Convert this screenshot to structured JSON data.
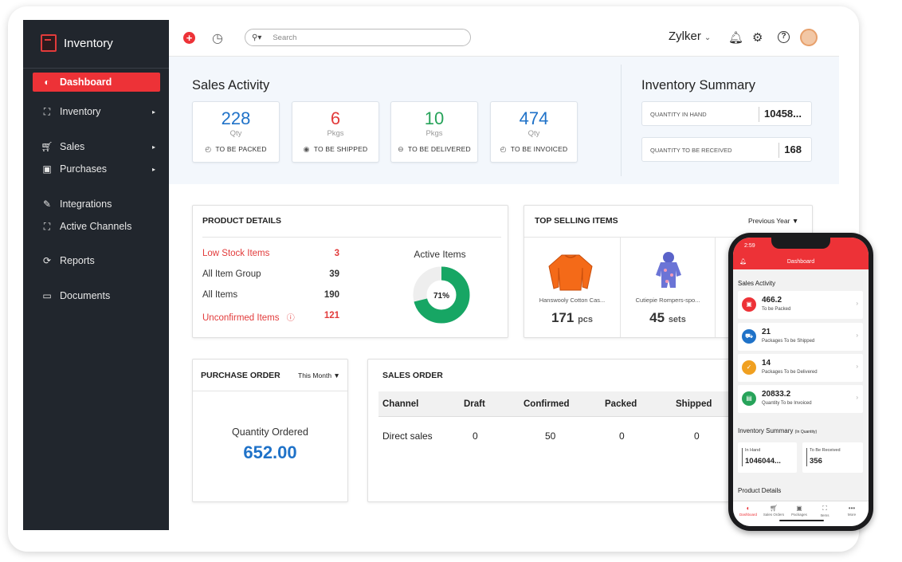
{
  "sidebar": {
    "app_name": "Inventory",
    "items": [
      {
        "label": "Dashboard",
        "icon": "dashboard-icon"
      },
      {
        "label": "Inventory",
        "icon": "inventory-icon",
        "arrow": "▸"
      },
      {
        "label": "Sales",
        "icon": "cart-icon",
        "arrow": "▸"
      },
      {
        "label": "Purchases",
        "icon": "bag-icon",
        "arrow": "▸"
      },
      {
        "label": "Integrations",
        "icon": "integrations-icon"
      },
      {
        "label": "Active Channels",
        "icon": "channels-icon"
      },
      {
        "label": "Reports",
        "icon": "reports-icon"
      },
      {
        "label": "Documents",
        "icon": "folder-icon"
      }
    ]
  },
  "topbar": {
    "search_placeholder": "Search",
    "org_name": "Zylker"
  },
  "sales_activity": {
    "title": "Sales Activity",
    "cards": [
      {
        "value": "228",
        "unit": "Qty",
        "label": "TO BE PACKED",
        "color": "#1f72c8"
      },
      {
        "value": "6",
        "unit": "Pkgs",
        "label": "TO BE SHIPPED",
        "color": "#e23b3b"
      },
      {
        "value": "10",
        "unit": "Pkgs",
        "label": "TO BE DELIVERED",
        "color": "#27a35a"
      },
      {
        "value": "474",
        "unit": "Qty",
        "label": "TO BE INVOICED",
        "color": "#1f72c8"
      }
    ]
  },
  "inventory_summary": {
    "title": "Inventory Summary",
    "in_hand_label": "QUANTITY IN HAND",
    "in_hand_value": "10458...",
    "to_receive_label": "QUANTITY TO BE RECEIVED",
    "to_receive_value": "168"
  },
  "product_details": {
    "title": "PRODUCT DETAILS",
    "rows": [
      {
        "label": "Low Stock Items",
        "value": "3",
        "alert": true
      },
      {
        "label": "All Item Group",
        "value": "39",
        "alert": false
      },
      {
        "label": "All Items",
        "value": "190",
        "alert": false
      },
      {
        "label": "Unconfirmed Items",
        "value": "121",
        "alert": true
      }
    ],
    "active_items_label": "Active Items",
    "active_items_percent": "71%",
    "active_items_fraction": 0.71
  },
  "top_selling": {
    "title": "TOP SELLING ITEMS",
    "period": "Previous Year",
    "items": [
      {
        "name": "Hanswooly Cotton Cas...",
        "value": "171",
        "unit": "pcs"
      },
      {
        "name": "Cutiepie Rompers-spo...",
        "value": "45",
        "unit": "sets"
      }
    ]
  },
  "purchase_order": {
    "title": "PURCHASE ORDER",
    "period": "This Month",
    "qty_label": "Quantity Ordered",
    "qty_value": "652.00"
  },
  "sales_order": {
    "title": "SALES ORDER",
    "columns": [
      "Channel",
      "Draft",
      "Confirmed",
      "Packed",
      "Shipped"
    ],
    "rows": [
      [
        "Direct sales",
        "0",
        "50",
        "0",
        "0"
      ]
    ]
  },
  "mobile": {
    "time": "2:59",
    "title": "Dashboard",
    "sales_activity_label": "Sales Activity",
    "cards": [
      {
        "value": "466.2",
        "label": "To be Packed",
        "color": "#ed3237"
      },
      {
        "value": "21",
        "label": "Packages To be Shipped",
        "color": "#1f72c8"
      },
      {
        "value": "14",
        "label": "Packages To be Delivered",
        "color": "#f0a020"
      },
      {
        "value": "20833.2",
        "label": "Quantity To be Invoiced",
        "color": "#27a35a"
      }
    ],
    "inventory_summary_label": "Inventory Summary",
    "inventory_summary_note": "(In Quantity)",
    "in_hand_label": "In Hand",
    "in_hand_value": "1046044...",
    "to_receive_label": "To Be Received",
    "to_receive_value": "356",
    "product_details_label": "Product Details",
    "tabs": [
      "Dashboard",
      "Sales Orders",
      "Packages",
      "Items",
      "More"
    ]
  }
}
